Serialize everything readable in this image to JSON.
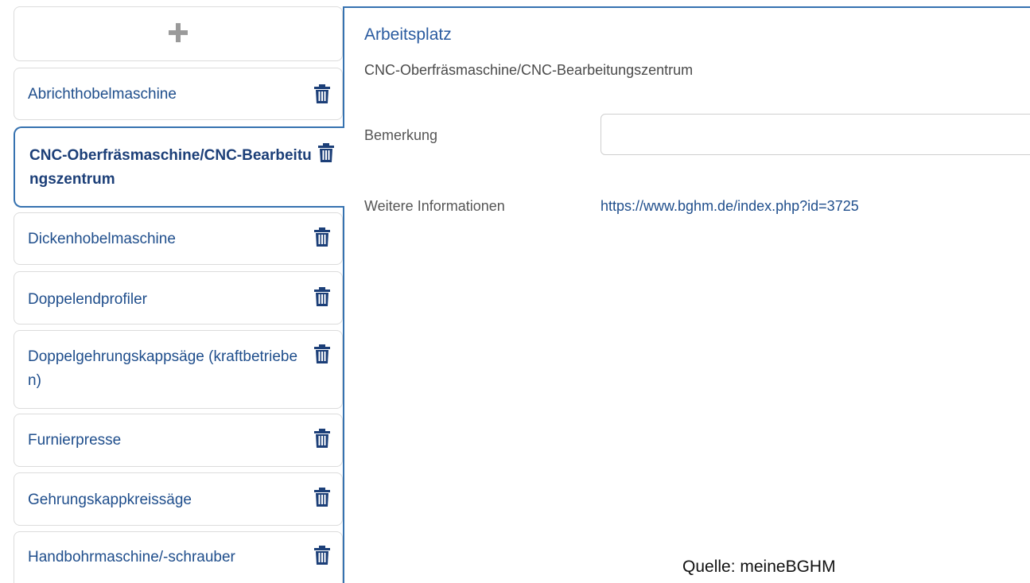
{
  "sidebar": {
    "add_icon": "plus-icon",
    "items": [
      {
        "label": "Abrichthobelmaschine",
        "icon": "trash-icon"
      },
      {
        "label": "CNC-Oberfräsmaschine/CNC-Bearbeitungszentrum",
        "icon": "trash-icon",
        "active": true
      },
      {
        "label": "Dickenhobelmaschine",
        "icon": "trash-icon"
      },
      {
        "label": "Doppelendprofiler",
        "icon": "trash-icon"
      },
      {
        "label": "Doppelgehrungskappsäge (kraftbetrieben)",
        "icon": "trash-icon"
      },
      {
        "label": "Furnierpresse",
        "icon": "trash-icon"
      },
      {
        "label": "Gehrungskappkreissäge",
        "icon": "trash-icon"
      },
      {
        "label": "Handbohrmaschine/-schrauber",
        "icon": "trash-icon"
      }
    ]
  },
  "detail": {
    "title": "Arbeitsplatz",
    "subtitle": "CNC-Oberfräsmaschine/CNC-Bearbeitungszentrum",
    "remark_label": "Bemerkung",
    "remark_value": "",
    "info_label": "Weitere Informationen",
    "info_link": "https://www.bghm.de/index.php?id=3725"
  },
  "source": "Quelle: meineBGHM",
  "colors": {
    "accent": "#3672b0",
    "link": "#1f4e8c",
    "border": "#dcdcdc"
  }
}
